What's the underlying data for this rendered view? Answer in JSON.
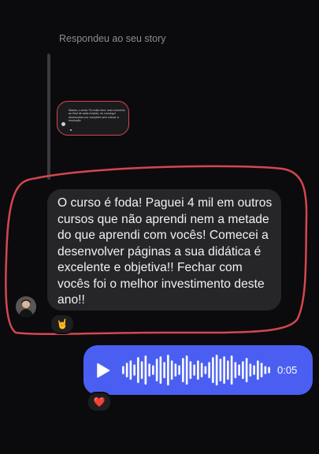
{
  "thread": {
    "replied_label": "Respondeu ao seu story"
  },
  "story": {
    "preview_text": "Massa, o curso Tá muito bem, todo exercício ao final de cada módulo, eu consegui desenvolver por completo sem checar a resolução"
  },
  "message": {
    "text": "O curso é foda! Paguei 4 mil em outros cursos que não aprendi nem a metade do que aprendi com vocês! Comecei a desenvolver páginas a sua didática é excelente e objetiva!! Fechar com vocês foi o melhor investimento deste ano!!",
    "reaction": "🤘"
  },
  "audio": {
    "duration": "0:05",
    "reaction": "❤️",
    "accent_color": "#4a5ff2",
    "waveform_levels": [
      0.25,
      0.45,
      0.6,
      0.35,
      0.8,
      0.55,
      0.9,
      0.4,
      0.3,
      0.7,
      0.85,
      0.5,
      0.95,
      0.6,
      0.4,
      0.3,
      0.75,
      0.9,
      0.55,
      0.35,
      0.6,
      0.45,
      0.25,
      0.5,
      0.8,
      0.95,
      0.7,
      0.85,
      0.6,
      0.9,
      0.5,
      0.35,
      0.55,
      0.75,
      0.4,
      0.3,
      0.6,
      0.45,
      0.25,
      0.2
    ]
  },
  "colors": {
    "background": "#0b0b0d",
    "bubble": "#262629",
    "highlight": "#d4474f"
  }
}
